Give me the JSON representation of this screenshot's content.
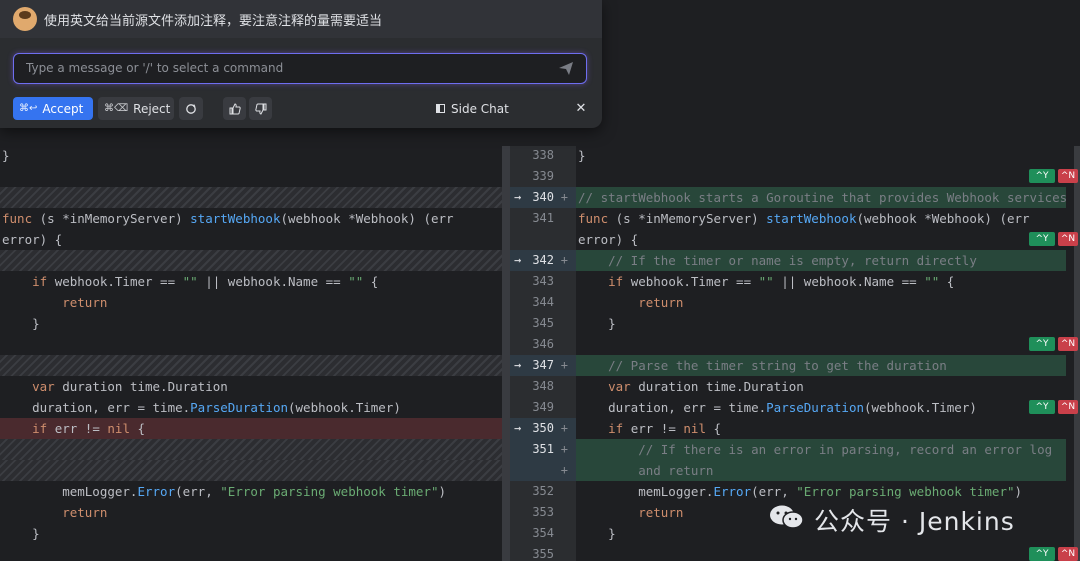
{
  "chat": {
    "prompt": "使用英文给当前源文件添加注释，要注意注释的量需要适当",
    "input_placeholder": "Type a message or '/' to select a command",
    "accept_key": "⌘↩",
    "accept_label": "Accept",
    "reject_key": "⌘⌫",
    "reject_label": "Reject",
    "side_chat_label": "Side Chat",
    "close": "✕"
  },
  "left_code": [
    {
      "row": 0,
      "type": "normal",
      "text": "}"
    },
    {
      "row": 1,
      "type": "blank",
      "text": ""
    },
    {
      "row": 2,
      "type": "hatch",
      "text": ""
    },
    {
      "row": 3,
      "type": "normal",
      "text": "func (s *inMemoryServer) startWebhook(webhook *Webhook) (err"
    },
    {
      "row": 4,
      "type": "normal",
      "text": "error) {"
    },
    {
      "row": 5,
      "type": "hatch",
      "text": ""
    },
    {
      "row": 6,
      "type": "normal",
      "text": "    if webhook.Timer == \"\" || webhook.Name == \"\" {"
    },
    {
      "row": 7,
      "type": "normal",
      "text": "        return"
    },
    {
      "row": 8,
      "type": "normal",
      "text": "    }"
    },
    {
      "row": 9,
      "type": "blank",
      "text": ""
    },
    {
      "row": 10,
      "type": "hatch",
      "text": ""
    },
    {
      "row": 11,
      "type": "normal",
      "text": "    var duration time.Duration"
    },
    {
      "row": 12,
      "type": "normal",
      "text": "    duration, err = time.ParseDuration(webhook.Timer)"
    },
    {
      "row": 13,
      "type": "del",
      "text": "    if err != nil {"
    },
    {
      "row": 14,
      "type": "hatch",
      "text": ""
    },
    {
      "row": 15,
      "type": "hatch",
      "text": ""
    },
    {
      "row": 16,
      "type": "normal",
      "text": "        memLogger.Error(err, \"Error parsing webhook timer\")"
    },
    {
      "row": 17,
      "type": "normal",
      "text": "        return"
    },
    {
      "row": 18,
      "type": "normal",
      "text": "    }"
    },
    {
      "row": 19,
      "type": "blank",
      "text": ""
    }
  ],
  "right_code": [
    {
      "row": 0,
      "type": "normal",
      "text": "}"
    },
    {
      "row": 1,
      "type": "blank",
      "text": ""
    },
    {
      "row": 2,
      "type": "add",
      "text": "// startWebhook starts a Goroutine that provides Webhook services"
    },
    {
      "row": 3,
      "type": "normal",
      "text": "func (s *inMemoryServer) startWebhook(webhook *Webhook) (err"
    },
    {
      "row": 4,
      "type": "normal",
      "text": "error) {"
    },
    {
      "row": 5,
      "type": "add",
      "text": "    // If the timer or name is empty, return directly"
    },
    {
      "row": 6,
      "type": "normal",
      "text": "    if webhook.Timer == \"\" || webhook.Name == \"\" {"
    },
    {
      "row": 7,
      "type": "normal",
      "text": "        return"
    },
    {
      "row": 8,
      "type": "normal",
      "text": "    }"
    },
    {
      "row": 9,
      "type": "blank",
      "text": ""
    },
    {
      "row": 10,
      "type": "add",
      "text": "    // Parse the timer string to get the duration"
    },
    {
      "row": 11,
      "type": "normal",
      "text": "    var duration time.Duration"
    },
    {
      "row": 12,
      "type": "normal",
      "text": "    duration, err = time.ParseDuration(webhook.Timer)"
    },
    {
      "row": 13,
      "type": "normal",
      "text": "    if err != nil {"
    },
    {
      "row": 14,
      "type": "add",
      "text": "        // If there is an error in parsing, record an error log"
    },
    {
      "row": 15,
      "type": "add",
      "text": "        and return"
    },
    {
      "row": 16,
      "type": "normal",
      "text": "        memLogger.Error(err, \"Error parsing webhook timer\")"
    },
    {
      "row": 17,
      "type": "normal",
      "text": "        return"
    },
    {
      "row": 18,
      "type": "normal",
      "text": "    }"
    },
    {
      "row": 19,
      "type": "blank",
      "text": ""
    }
  ],
  "gutter": [
    {
      "row": 0,
      "num": "338",
      "arrow": "",
      "plus": ""
    },
    {
      "row": 1,
      "num": "339",
      "arrow": "",
      "plus": ""
    },
    {
      "row": 2,
      "num": "340",
      "arrow": "→",
      "plus": "+"
    },
    {
      "row": 3,
      "num": "341",
      "arrow": "",
      "plus": ""
    },
    {
      "row": 4,
      "num": "",
      "arrow": "",
      "plus": ""
    },
    {
      "row": 5,
      "num": "342",
      "arrow": "→",
      "plus": "+"
    },
    {
      "row": 6,
      "num": "343",
      "arrow": "",
      "plus": ""
    },
    {
      "row": 7,
      "num": "344",
      "arrow": "",
      "plus": ""
    },
    {
      "row": 8,
      "num": "345",
      "arrow": "",
      "plus": ""
    },
    {
      "row": 9,
      "num": "346",
      "arrow": "",
      "plus": ""
    },
    {
      "row": 10,
      "num": "347",
      "arrow": "→",
      "plus": "+"
    },
    {
      "row": 11,
      "num": "348",
      "arrow": "",
      "plus": ""
    },
    {
      "row": 12,
      "num": "349",
      "arrow": "",
      "plus": ""
    },
    {
      "row": 13,
      "num": "350",
      "arrow": "→",
      "plus": "+"
    },
    {
      "row": 14,
      "num": "351",
      "arrow": "",
      "plus": "+"
    },
    {
      "row": 15,
      "num": "",
      "arrow": "",
      "plus": "+"
    },
    {
      "row": 16,
      "num": "352",
      "arrow": "",
      "plus": ""
    },
    {
      "row": 17,
      "num": "353",
      "arrow": "",
      "plus": ""
    },
    {
      "row": 18,
      "num": "354",
      "arrow": "",
      "plus": ""
    },
    {
      "row": 19,
      "num": "355",
      "arrow": "",
      "plus": ""
    }
  ],
  "hunk_tags": {
    "yes": "^Y",
    "no": "^N",
    "rows": [
      1,
      4,
      9,
      12,
      19
    ]
  },
  "watermark": "公众号 · Jenkins",
  "colors": {
    "accent": "#3574f0",
    "added": "#28473a",
    "deleted": "#4a2a2e",
    "keyword": "#cf8e6d",
    "function": "#56a8f5",
    "string": "#6aab73",
    "comment": "#7a7e85"
  }
}
